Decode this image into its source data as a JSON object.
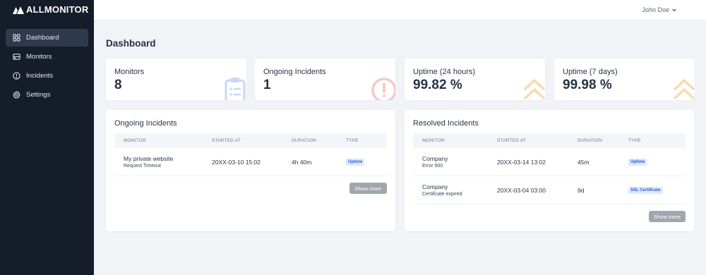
{
  "brand": {
    "name": "ALLMONITOR"
  },
  "sidebar": {
    "items": [
      {
        "label": "Dashboard",
        "icon": "grid-icon",
        "active": true
      },
      {
        "label": "Monitors",
        "icon": "server-icon",
        "active": false
      },
      {
        "label": "Incidents",
        "icon": "alert-circle-icon",
        "active": false
      },
      {
        "label": "Settings",
        "icon": "gear-icon",
        "active": false
      }
    ]
  },
  "topbar": {
    "user_name": "John Doe"
  },
  "page": {
    "title": "Dashboard"
  },
  "stats": [
    {
      "label": "Monitors",
      "value": "8",
      "icon": "clipboard-icon",
      "icon_color": "#c9d7f4"
    },
    {
      "label": "Ongoing Incidents",
      "value": "1",
      "icon": "alert-circle-icon",
      "icon_color": "#f7c7c3"
    },
    {
      "label": "Uptime (24 hours)",
      "value": "99.82 %",
      "icon": "double-chevron-up-icon",
      "icon_color": "#fbd9b0"
    },
    {
      "label": "Uptime (7 days)",
      "value": "99.98 %",
      "icon": "double-chevron-up-icon",
      "icon_color": "#fbd9b0"
    }
  ],
  "ongoing": {
    "title": "Ongoing Incidents",
    "columns": [
      "MONITOR",
      "STARTED AT",
      "DURATION",
      "TYPE"
    ],
    "rows": [
      {
        "monitor": "My private website",
        "detail": "Request Timeout",
        "started": "20XX-03-10 15:02",
        "duration": "4h 40m",
        "type": "Uptime"
      }
    ],
    "show_more": "Show more"
  },
  "resolved": {
    "title": "Resolved Incidents",
    "columns": [
      "MONITOR",
      "STARTED AT",
      "DURATION",
      "TYPE"
    ],
    "rows": [
      {
        "monitor": "Company",
        "detail": "Error 500",
        "started": "20XX-03-14 13:02",
        "duration": "45m",
        "type": "Uptime"
      },
      {
        "monitor": "Company",
        "detail": "Certificate expired",
        "started": "20XX-03-04 03:00",
        "duration": "9d",
        "type": "SSL Certificate"
      }
    ],
    "show_more": "Show more"
  },
  "colors": {
    "sidebar_bg": "#151d2b",
    "accent_badge": "#2d5fc4",
    "page_bg": "#f1f3f7"
  }
}
